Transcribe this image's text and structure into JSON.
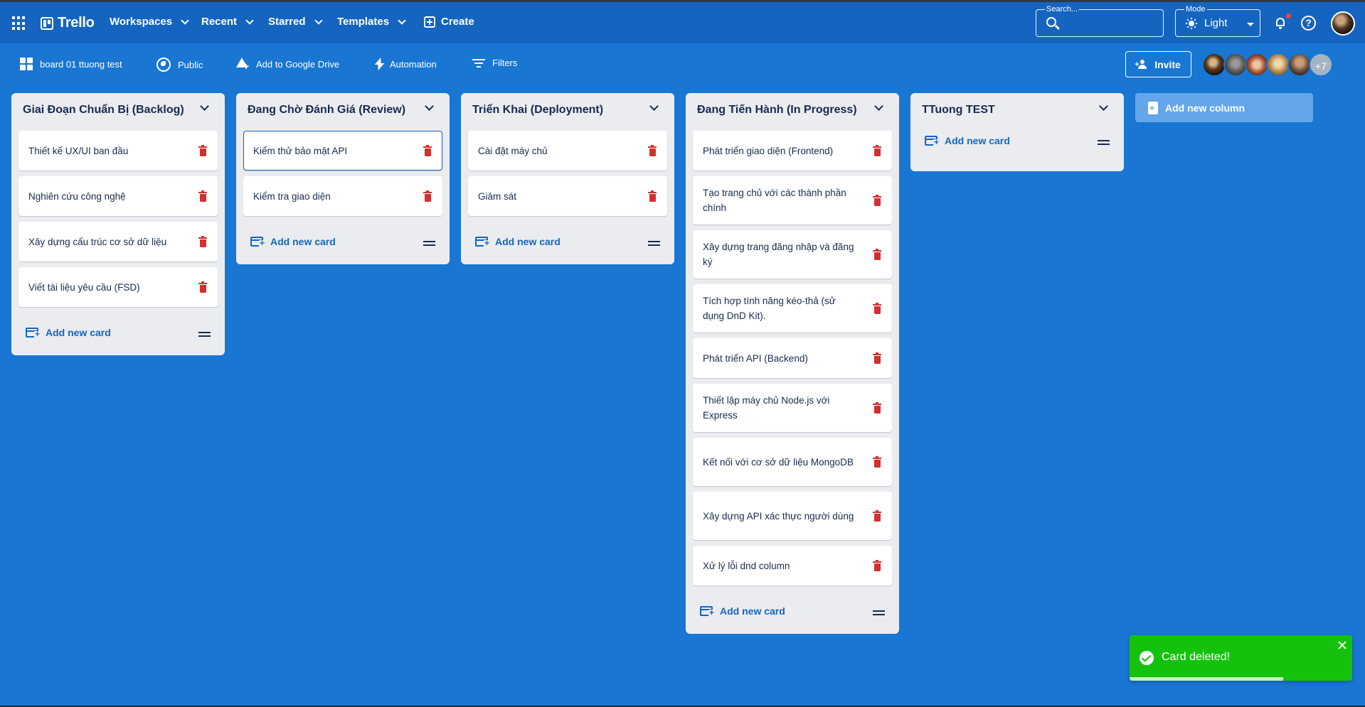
{
  "header": {
    "app_name": "Trello",
    "nav": [
      {
        "label": "Workspaces",
        "has_dropdown": true
      },
      {
        "label": "Recent",
        "has_dropdown": true
      },
      {
        "label": "Starred",
        "has_dropdown": true
      },
      {
        "label": "Templates",
        "has_dropdown": true
      },
      {
        "label": "Create",
        "has_dropdown": false
      }
    ],
    "search": {
      "label": "Search...",
      "value": ""
    },
    "mode": {
      "label": "Mode",
      "value": "Light"
    },
    "notification_dot_color": "#f44336"
  },
  "boardbar": {
    "board_name": "board 01 ttuong test",
    "visibility": "Public",
    "drive": "Add to Google Drive",
    "automation": "Automation",
    "filters": "Filters",
    "invite": "Invite",
    "more_members": "+7"
  },
  "columns": [
    {
      "title": "Giai Đoạn Chuẩn Bị (Backlog)",
      "cards": [
        {
          "text": "Thiết kế UX/UI ban đầu"
        },
        {
          "text": "Nghiên cứu công nghệ"
        },
        {
          "text": "Xây dựng cấu trúc cơ sở dữ liệu"
        },
        {
          "text": "Viết tài liệu yêu cầu (FSD)"
        }
      ],
      "add_label": "Add new card"
    },
    {
      "title": "Đang Chờ Đánh Giá (Review)",
      "cards": [
        {
          "text": "Kiểm thử bảo mật API",
          "focused": true
        },
        {
          "text": "Kiểm tra giao diện"
        }
      ],
      "add_label": "Add new card"
    },
    {
      "title": "Triển Khai (Deployment)",
      "cards": [
        {
          "text": "Cài đặt máy chủ"
        },
        {
          "text": "Giám sát"
        }
      ],
      "add_label": "Add new card"
    },
    {
      "title": "Đang Tiến Hành (In Progress)",
      "cards": [
        {
          "text": "Phát triển giao diện (Frontend)"
        },
        {
          "text": "Tạo trang chủ với các thành phần chính",
          "two_line": true
        },
        {
          "text": "Xây dựng trang đăng nhập và đăng ký",
          "two_line": true
        },
        {
          "text": "Tích hợp tính năng kéo-thả (sử dụng DnD Kit).",
          "two_line": true
        },
        {
          "text": "Phát triển API (Backend)"
        },
        {
          "text": "Thiết lập máy chủ Node.js với Express",
          "two_line": true
        },
        {
          "text": "Kết nối với cơ sở dữ liệu MongoDB",
          "two_line": true
        },
        {
          "text": "Xây dựng API xác thực người dùng",
          "two_line": true
        },
        {
          "text": "Xử lý lỗi dnd column"
        }
      ],
      "add_label": "Add new card"
    },
    {
      "title": "TTuong TEST",
      "cards": [],
      "add_label": "Add new card"
    }
  ],
  "add_column_label": "Add new column",
  "toast": {
    "message": "Card deleted!",
    "progress": 0.69,
    "color": "#14c20e"
  },
  "colors": {
    "board_bg": "#1976d2",
    "header_bg": "#1565c0",
    "column_bg": "#ebecf0",
    "delete_red": "#d32f2f"
  }
}
